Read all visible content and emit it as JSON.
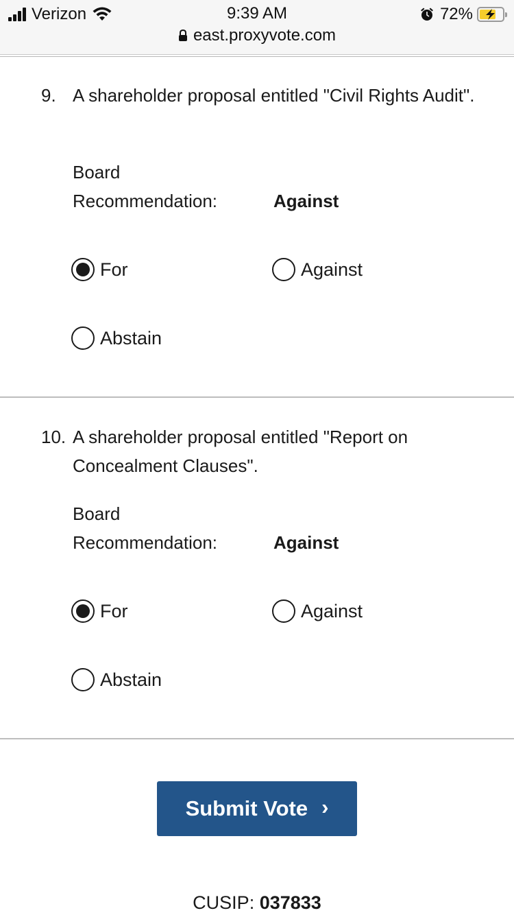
{
  "status": {
    "carrier": "Verizon",
    "time": "9:39 AM",
    "battery_percent": "72%",
    "battery_level": 0.72,
    "url": "east.proxyvote.com",
    "icons": [
      "signal-icon",
      "wifi-icon",
      "alarm-icon",
      "battery-icon",
      "lock-icon"
    ]
  },
  "proposals": [
    {
      "number": "9.",
      "title": "A shareholder proposal entitled \"Civil Rights Audit\".",
      "board_label": "Board Recommendation:",
      "board_value": "Against",
      "options": [
        "For",
        "Against",
        "Abstain"
      ],
      "selected": "For"
    },
    {
      "number": "10.",
      "title": "A shareholder proposal entitled \"Report on Concealment Clauses\".",
      "board_label": "Board Recommendation:",
      "board_value": "Against",
      "options": [
        "For",
        "Against",
        "Abstain"
      ],
      "selected": "For"
    }
  ],
  "submit": {
    "label": "Submit Vote",
    "chevron": "›"
  },
  "cusip": {
    "label": "CUSIP:",
    "value": "037833"
  },
  "colors": {
    "accent": "#23558a",
    "battery": "#f5cd2b"
  }
}
